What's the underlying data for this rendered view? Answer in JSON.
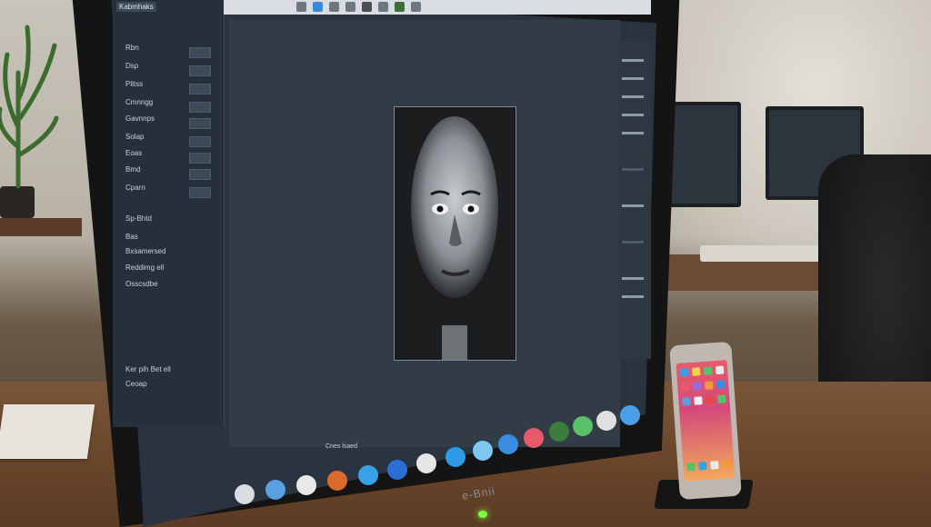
{
  "scene": {
    "description_free": true
  },
  "software": {
    "panel_title": "Kabmhaks",
    "sidebar_items": [
      {
        "label": "Rbn"
      },
      {
        "label": "Dsp"
      },
      {
        "label": "Plitss"
      },
      {
        "label": "Cmnngg"
      },
      {
        "label": "Gavnnps"
      },
      {
        "label": "Solap"
      },
      {
        "label": "Eoas"
      },
      {
        "label": "Bmd"
      },
      {
        "label": "Cparn"
      },
      {
        "label": "Sp-Bhtd"
      },
      {
        "label": "Bas"
      },
      {
        "label": "Bxsamersed"
      },
      {
        "label": "Reddimg ell"
      },
      {
        "label": "Osscsdbe"
      },
      {
        "label": "Ker pih Bet ell"
      },
      {
        "label": "Ceoap"
      }
    ],
    "status_text": "Cnes lsaed",
    "brand": "e-Bnii"
  },
  "colors": {
    "screen_bg": "#2a3440",
    "power_led": "#7bff3c"
  },
  "icons": [
    "toolbar-icon",
    "dock-icon",
    "phone-app-icon"
  ]
}
